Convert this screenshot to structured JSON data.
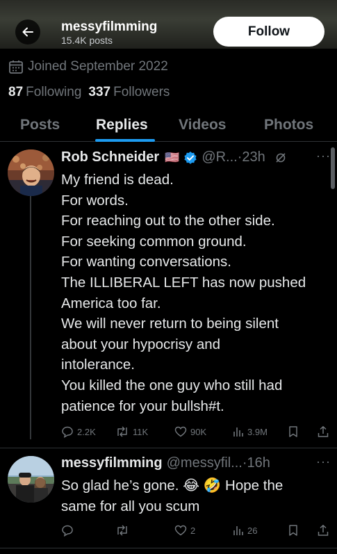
{
  "header": {
    "name": "messyfilmming",
    "posts": "15.4K posts",
    "follow_label": "Follow"
  },
  "profile": {
    "joined": "Joined September 2022",
    "following_count": "87",
    "following_label": "Following",
    "followers_count": "337",
    "followers_label": "Followers"
  },
  "tabs": [
    "Posts",
    "Replies",
    "Videos",
    "Photos"
  ],
  "tweet1": {
    "name": "Rob Schneider",
    "flag": "🇺🇸",
    "handle": "@R...",
    "time": "23h",
    "lines": [
      "My friend is dead.",
      "For words.",
      "For reaching out to the other side.",
      "For seeking common ground.",
      "For wanting conversations.",
      "The ILLIBERAL LEFT has now pushed",
      "America too far.",
      "We will never return to being silent",
      "about your hypocrisy and",
      "intolerance.",
      "You killed the one guy who still had",
      "patience for your bullsh#t."
    ],
    "replies": "2.2K",
    "reposts": "11K",
    "likes": "90K",
    "views": "3.9M"
  },
  "tweet2": {
    "name": "messyfilmming",
    "handle": "@messyfil...",
    "time": "16h",
    "line1_a": "So glad he’s gone. ",
    "line1_b": " Hope the",
    "line2": "same for all you scum",
    "emoji1": "😂",
    "emoji2": "🤣",
    "replies": "",
    "reposts": "",
    "likes": "2",
    "views": "26"
  },
  "colors": {
    "accent": "#1d9bf0",
    "muted": "#71767b",
    "text": "#e7e9ea",
    "background": "#000000"
  }
}
